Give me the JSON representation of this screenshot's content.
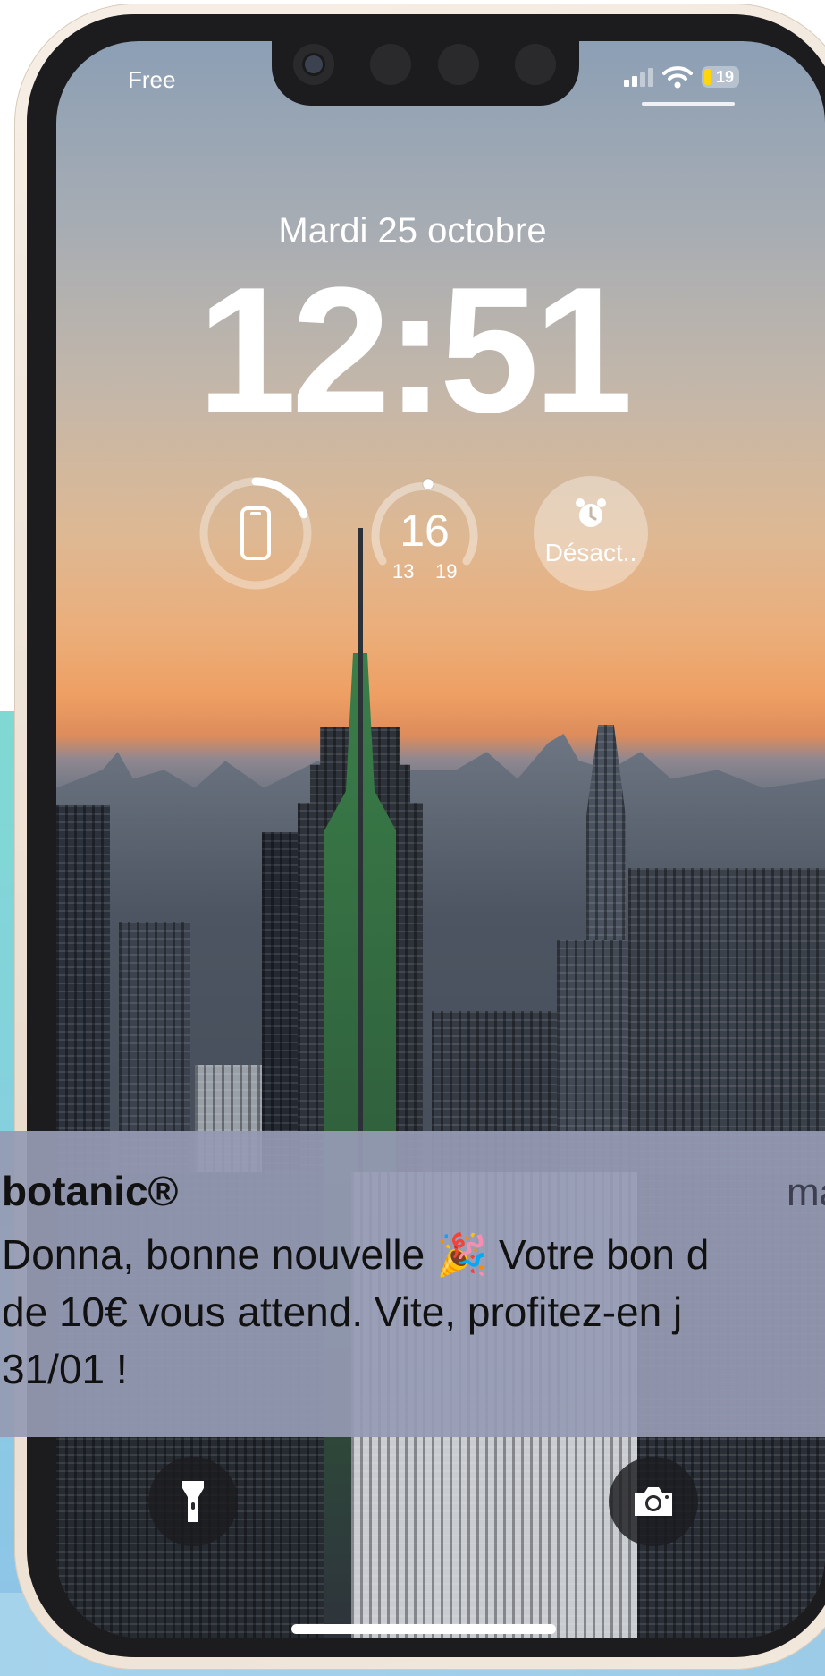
{
  "status_bar": {
    "carrier": "Free",
    "battery_level": "19",
    "battery_color": "#ffd60a",
    "signal_bars_active": 2,
    "signal_bars_total": 4
  },
  "lock_screen": {
    "date": "Mardi 25 octobre",
    "time": "12:51"
  },
  "widgets": {
    "phone_battery": {
      "icon": "phone-icon",
      "level_percent": 19
    },
    "temperature": {
      "current": "16",
      "low": "13",
      "high": "19"
    },
    "alarm": {
      "icon": "alarm-clock-icon",
      "label": "Désact.."
    }
  },
  "notification": {
    "app": "botanic®",
    "time": "ma",
    "body": "Donna, bonne nouvelle 🎉 Votre bon d\nde 10€ vous attend. Vite, profitez-en j\n31/01 !"
  },
  "quick_actions": {
    "left_icon": "flashlight-icon",
    "right_icon": "camera-icon"
  }
}
